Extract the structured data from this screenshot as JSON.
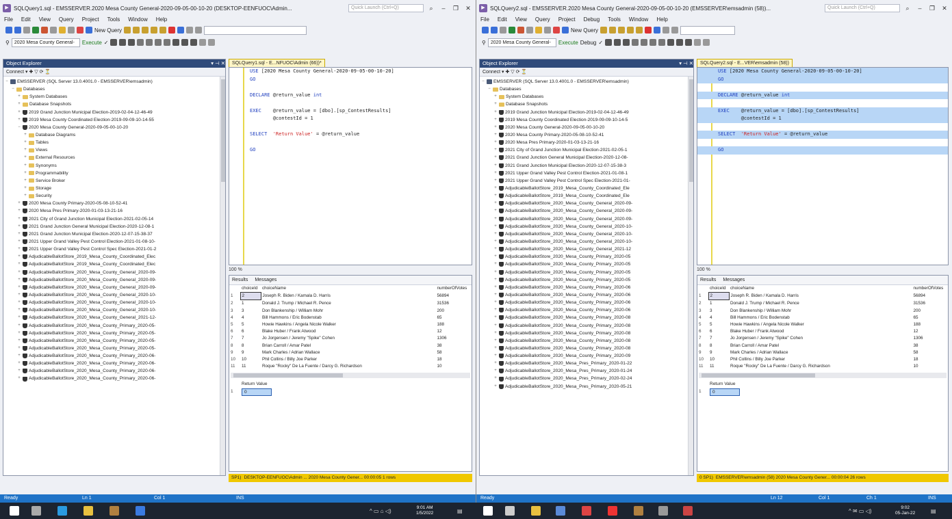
{
  "left": {
    "title": "SQLQuery1.sql - EMSSERVER.2020 Mesa County General-2020-09-05-00-10-20 (DESKTOP-EENFUOC\\Admin...",
    "quick_launch": "Quick Launch (Ctrl+Q)",
    "menu": [
      "File",
      "Edit",
      "View",
      "Query",
      "Project",
      "Tools",
      "Window",
      "Help"
    ],
    "new_query": "New Query",
    "db_combo": "2020 Mesa County General-",
    "execute": "Execute",
    "explorer_title": "Object Explorer",
    "connect": "Connect",
    "server": "EMSSERVER (SQL Server 13.0.4001.0 - EMSSERVER\\emsadmin)",
    "tree": [
      {
        "label": "Databases",
        "level": 1,
        "icon": "folder-icon",
        "ex": "−"
      },
      {
        "label": "System Databases",
        "level": 2,
        "icon": "folder-icon",
        "ex": "+"
      },
      {
        "label": "Database Snapshots",
        "level": 2,
        "icon": "folder-icon",
        "ex": "+"
      },
      {
        "label": "2019 Grand Junction Municipal Election-2019-02-04-12-46-49",
        "level": 2,
        "icon": "database-icon",
        "ex": "+"
      },
      {
        "label": "2019 Mesa County Coordinated Election-2019-09-09-10-14-55",
        "level": 2,
        "icon": "database-icon",
        "ex": "+"
      },
      {
        "label": "2020 Mesa County General-2020-09-05-00-10-20",
        "level": 2,
        "icon": "database-icon",
        "ex": "−"
      },
      {
        "label": "Database Diagrams",
        "level": 3,
        "icon": "folder-icon",
        "ex": "+"
      },
      {
        "label": "Tables",
        "level": 3,
        "icon": "folder-icon",
        "ex": "+"
      },
      {
        "label": "Views",
        "level": 3,
        "icon": "folder-icon",
        "ex": "+"
      },
      {
        "label": "External Resources",
        "level": 3,
        "icon": "folder-icon",
        "ex": "+"
      },
      {
        "label": "Synonyms",
        "level": 3,
        "icon": "folder-icon",
        "ex": "+"
      },
      {
        "label": "Programmability",
        "level": 3,
        "icon": "folder-icon",
        "ex": "+"
      },
      {
        "label": "Service Broker",
        "level": 3,
        "icon": "folder-icon",
        "ex": "+"
      },
      {
        "label": "Storage",
        "level": 3,
        "icon": "folder-icon",
        "ex": "+"
      },
      {
        "label": "Security",
        "level": 3,
        "icon": "folder-icon",
        "ex": "+"
      },
      {
        "label": "2020 Mesa County Primary-2020-05-08-10-52-41",
        "level": 2,
        "icon": "database-icon",
        "ex": "+"
      },
      {
        "label": "2020 Mesa Pres Primary-2020-01-03-13-21-16",
        "level": 2,
        "icon": "database-icon",
        "ex": "+"
      },
      {
        "label": "2021 City of Grand Junction Municipal Election-2021-02-05-14",
        "level": 2,
        "icon": "database-icon",
        "ex": "+"
      },
      {
        "label": "2021 Grand Junction General Municipal Election-2020-12-08-1",
        "level": 2,
        "icon": "database-icon",
        "ex": "+"
      },
      {
        "label": "2021 Grand Junction Municipal Election-2020-12-07-15-38-37",
        "level": 2,
        "icon": "database-icon",
        "ex": "+"
      },
      {
        "label": "2021 Upper Grand Valley Pest Control Election-2021-01-08-10-",
        "level": 2,
        "icon": "database-icon",
        "ex": "+"
      },
      {
        "label": "2021 Upper Grand Valley Pest Control Spec Election-2021-01-2",
        "level": 2,
        "icon": "database-icon",
        "ex": "+"
      },
      {
        "label": "AdjudicableBallotStore_2019_Mesa_County_Coordinated_Elec",
        "level": 2,
        "icon": "database-icon",
        "ex": "+"
      },
      {
        "label": "AdjudicableBallotStore_2019_Mesa_County_Coordinated_Elec",
        "level": 2,
        "icon": "database-icon",
        "ex": "+"
      },
      {
        "label": "AdjudicableBallotStore_2020_Mesa_County_General_2020-09-",
        "level": 2,
        "icon": "database-icon",
        "ex": "+"
      },
      {
        "label": "AdjudicableBallotStore_2020_Mesa_County_General_2020-09-",
        "level": 2,
        "icon": "database-icon",
        "ex": "+"
      },
      {
        "label": "AdjudicableBallotStore_2020_Mesa_County_General_2020-09-",
        "level": 2,
        "icon": "database-icon",
        "ex": "+"
      },
      {
        "label": "AdjudicableBallotStore_2020_Mesa_County_General_2020-10-",
        "level": 2,
        "icon": "database-icon",
        "ex": "+"
      },
      {
        "label": "AdjudicableBallotStore_2020_Mesa_County_General_2020-10-",
        "level": 2,
        "icon": "database-icon",
        "ex": "+"
      },
      {
        "label": "AdjudicableBallotStore_2020_Mesa_County_General_2020-10-",
        "level": 2,
        "icon": "database-icon",
        "ex": "+"
      },
      {
        "label": "AdjudicableBallotStore_2020_Mesa_County_General_2021-12-",
        "level": 2,
        "icon": "database-icon",
        "ex": "+"
      },
      {
        "label": "AdjudicableBallotStore_2020_Mesa_County_Primary_2020-05-",
        "level": 2,
        "icon": "database-icon",
        "ex": "+"
      },
      {
        "label": "AdjudicableBallotStore_2020_Mesa_County_Primary_2020-05-",
        "level": 2,
        "icon": "database-icon",
        "ex": "+"
      },
      {
        "label": "AdjudicableBallotStore_2020_Mesa_County_Primary_2020-05-",
        "level": 2,
        "icon": "database-icon",
        "ex": "+"
      },
      {
        "label": "AdjudicableBallotStore_2020_Mesa_County_Primary_2020-05-",
        "level": 2,
        "icon": "database-icon",
        "ex": "+"
      },
      {
        "label": "AdjudicableBallotStore_2020_Mesa_County_Primary_2020-06-",
        "level": 2,
        "icon": "database-icon",
        "ex": "+"
      },
      {
        "label": "AdjudicableBallotStore_2020_Mesa_County_Primary_2020-06-",
        "level": 2,
        "icon": "database-icon",
        "ex": "+"
      },
      {
        "label": "AdjudicableBallotStore_2020_Mesa_County_Primary_2020-06-",
        "level": 2,
        "icon": "database-icon",
        "ex": "+"
      },
      {
        "label": "AdjudicableBallotStore_2020_Mesa_County_Primary_2020-06-",
        "level": 2,
        "icon": "database-icon",
        "ex": "+"
      }
    ],
    "doc_tab": "SQLQuery1.sql - E...NFUOC\\Admin (66))*",
    "code": [
      {
        "t": [
          [
            "kw",
            "USE "
          ],
          [
            "",
            "[2020 Mesa County General-2020-09-05-00-10-20]"
          ]
        ]
      },
      {
        "t": [
          [
            "kw",
            "GO"
          ]
        ]
      },
      {
        "t": []
      },
      {
        "t": [
          [
            "kw",
            "DECLARE "
          ],
          [
            "",
            "@return_value "
          ],
          [
            "kw",
            "int"
          ]
        ]
      },
      {
        "t": []
      },
      {
        "t": [
          [
            "kw",
            "EXEC    "
          ],
          [
            "",
            "@return_value = [dbo].[sp_ContestResults]"
          ]
        ]
      },
      {
        "t": [
          [
            "",
            "        @contestId = 1"
          ]
        ]
      },
      {
        "t": []
      },
      {
        "t": [
          [
            "kw",
            "SELECT  "
          ],
          [
            "str",
            "'Return Value'"
          ],
          [
            "",
            " = @return_value"
          ]
        ]
      },
      {
        "t": []
      },
      {
        "t": [
          [
            "kw",
            "GO"
          ]
        ]
      }
    ],
    "zoom": "100 %",
    "results_tab": "Results",
    "messages_tab": "Messages",
    "status": "DESKTOP-EENFUOC\\Admin ...   2020 Mesa County Gener...   00:00:05   1 rows",
    "status_left": "SP1)",
    "vs_status": {
      "ready": "Ready",
      "ln": "Ln 1",
      "col": "Col 1",
      "ins": "INS"
    }
  },
  "right": {
    "title": "SQLQuery2.sql - EMSSERVER.2020 Mesa County General-2020-09-05-00-10-20 (EMSSERVER\\emsadmin (58))...",
    "quick_launch": "Quick Launch (Ctrl+Q)",
    "menu": [
      "File",
      "Edit",
      "View",
      "Query",
      "Project",
      "Debug",
      "Tools",
      "Window",
      "Help"
    ],
    "new_query": "New Query",
    "db_combo": "2020 Mesa County General-",
    "execute": "Execute",
    "debug": "Debug",
    "explorer_title": "Object Explorer",
    "connect": "Connect",
    "server": "EMSSERVER (SQL Server 13.0.4001.0 - EMSSERVER\\emsadmin)",
    "tree": [
      {
        "label": "Databases",
        "level": 1,
        "icon": "folder-icon",
        "ex": "−"
      },
      {
        "label": "System Databases",
        "level": 2,
        "icon": "folder-icon",
        "ex": "+"
      },
      {
        "label": "Database Snapshots",
        "level": 2,
        "icon": "folder-icon",
        "ex": "+"
      },
      {
        "label": "2019 Grand Junction Municipal Election-2019-02-04-12-46-49",
        "level": 2,
        "icon": "database-icon",
        "ex": "+"
      },
      {
        "label": "2019 Mesa County Coordinated Election-2019-09-09-10-14-5",
        "level": 2,
        "icon": "database-icon",
        "ex": "+"
      },
      {
        "label": "2020 Mesa County General-2020-09-05-00-10-20",
        "level": 2,
        "icon": "database-icon",
        "ex": "+"
      },
      {
        "label": "2020 Mesa County Primary-2020-05-08-10-52-41",
        "level": 2,
        "icon": "database-icon",
        "ex": "+"
      },
      {
        "label": "2020 Mesa Pres Primary-2020-01-03-13-21-16",
        "level": 2,
        "icon": "database-icon",
        "ex": "+"
      },
      {
        "label": "2021 City of Grand Junction Municipal Election-2021-02-05-1",
        "level": 2,
        "icon": "database-icon",
        "ex": "+"
      },
      {
        "label": "2021 Grand Junction General Municipal Election-2020-12-08-",
        "level": 2,
        "icon": "database-icon",
        "ex": "+"
      },
      {
        "label": "2021 Grand Junction Municipal Election-2020-12-07-15-38-3",
        "level": 2,
        "icon": "database-icon",
        "ex": "+"
      },
      {
        "label": "2021 Upper Grand Valley Pest Control Election-2021-01-08-1",
        "level": 2,
        "icon": "database-icon",
        "ex": "+"
      },
      {
        "label": "2021 Upper Grand Valley Pest Control Spec Election-2021-01-",
        "level": 2,
        "icon": "database-icon",
        "ex": "+"
      },
      {
        "label": "AdjudicableBallotStore_2019_Mesa_County_Coordinated_Ele",
        "level": 2,
        "icon": "database-icon",
        "ex": "+"
      },
      {
        "label": "AdjudicableBallotStore_2019_Mesa_County_Coordinated_Ele",
        "level": 2,
        "icon": "database-icon",
        "ex": "+"
      },
      {
        "label": "AdjudicableBallotStore_2020_Mesa_County_General_2020-09-",
        "level": 2,
        "icon": "database-icon",
        "ex": "+"
      },
      {
        "label": "AdjudicableBallotStore_2020_Mesa_County_General_2020-09-",
        "level": 2,
        "icon": "database-icon",
        "ex": "+"
      },
      {
        "label": "AdjudicableBallotStore_2020_Mesa_County_General_2020-09-",
        "level": 2,
        "icon": "database-icon",
        "ex": "+"
      },
      {
        "label": "AdjudicableBallotStore_2020_Mesa_County_General_2020-10-",
        "level": 2,
        "icon": "database-icon",
        "ex": "+"
      },
      {
        "label": "AdjudicableBallotStore_2020_Mesa_County_General_2020-10-",
        "level": 2,
        "icon": "database-icon",
        "ex": "+"
      },
      {
        "label": "AdjudicableBallotStore_2020_Mesa_County_General_2020-10-",
        "level": 2,
        "icon": "database-icon",
        "ex": "+"
      },
      {
        "label": "AdjudicableBallotStore_2020_Mesa_County_General_2021-12",
        "level": 2,
        "icon": "database-icon",
        "ex": "+"
      },
      {
        "label": "AdjudicableBallotStore_2020_Mesa_County_Primary_2020-05",
        "level": 2,
        "icon": "database-icon",
        "ex": "+"
      },
      {
        "label": "AdjudicableBallotStore_2020_Mesa_County_Primary_2020-05",
        "level": 2,
        "icon": "database-icon",
        "ex": "+"
      },
      {
        "label": "AdjudicableBallotStore_2020_Mesa_County_Primary_2020-05",
        "level": 2,
        "icon": "database-icon",
        "ex": "+"
      },
      {
        "label": "AdjudicableBallotStore_2020_Mesa_County_Primary_2020-05",
        "level": 2,
        "icon": "database-icon",
        "ex": "+"
      },
      {
        "label": "AdjudicableBallotStore_2020_Mesa_County_Primary_2020-06",
        "level": 2,
        "icon": "database-icon",
        "ex": "+"
      },
      {
        "label": "AdjudicableBallotStore_2020_Mesa_County_Primary_2020-06",
        "level": 2,
        "icon": "database-icon",
        "ex": "+"
      },
      {
        "label": "AdjudicableBallotStore_2020_Mesa_County_Primary_2020-06",
        "level": 2,
        "icon": "database-icon",
        "ex": "+"
      },
      {
        "label": "AdjudicableBallotStore_2020_Mesa_County_Primary_2020-06",
        "level": 2,
        "icon": "database-icon",
        "ex": "+"
      },
      {
        "label": "AdjudicableBallotStore_2020_Mesa_County_Primary_2020-08",
        "level": 2,
        "icon": "database-icon",
        "ex": "+"
      },
      {
        "label": "AdjudicableBallotStore_2020_Mesa_County_Primary_2020-08",
        "level": 2,
        "icon": "database-icon",
        "ex": "+"
      },
      {
        "label": "AdjudicableBallotStore_2020_Mesa_County_Primary_2020-08",
        "level": 2,
        "icon": "database-icon",
        "ex": "+"
      },
      {
        "label": "AdjudicableBallotStore_2020_Mesa_County_Primary_2020-08",
        "level": 2,
        "icon": "database-icon",
        "ex": "+"
      },
      {
        "label": "AdjudicableBallotStore_2020_Mesa_County_Primary_2020-08",
        "level": 2,
        "icon": "database-icon",
        "ex": "+"
      },
      {
        "label": "AdjudicableBallotStore_2020_Mesa_County_Primary_2020-09",
        "level": 2,
        "icon": "database-icon",
        "ex": "+"
      },
      {
        "label": "AdjudicableBallotStore_2020_Mesa_Pres_Primary_2020-01-22",
        "level": 2,
        "icon": "database-icon",
        "ex": "+"
      },
      {
        "label": "AdjudicableBallotStore_2020_Mesa_Pres_Primary_2020-01-24",
        "level": 2,
        "icon": "database-icon",
        "ex": "+"
      },
      {
        "label": "AdjudicableBallotStore_2020_Mesa_Pres_Primary_2020-02-24",
        "level": 2,
        "icon": "database-icon",
        "ex": "+"
      },
      {
        "label": "AdjudicableBallotStore_2020_Mesa_Pres_Primary_2020-05-21",
        "level": 2,
        "icon": "database-icon",
        "ex": "+"
      }
    ],
    "doc_tab": "SQLQuery2.sql - E...VER\\emsadmin (58))",
    "code": [
      {
        "t": [
          [
            "kw",
            "USE "
          ],
          [
            "",
            "[2020 Mesa County General-2020-09-05-00-10-20]"
          ]
        ]
      },
      {
        "t": [
          [
            "kw",
            "GO"
          ]
        ]
      },
      {
        "t": []
      },
      {
        "t": [
          [
            "kw",
            "DECLARE "
          ],
          [
            "",
            "@return_value "
          ],
          [
            "kw",
            "int"
          ]
        ]
      },
      {
        "t": []
      },
      {
        "t": [
          [
            "kw",
            "EXEC    "
          ],
          [
            "",
            "@return_value = [dbo].[sp_ContestResults]"
          ]
        ]
      },
      {
        "t": [
          [
            "",
            "        @contestId = 1"
          ]
        ]
      },
      {
        "t": []
      },
      {
        "t": [
          [
            "kw",
            "SELECT  "
          ],
          [
            "str",
            "'Return Value'"
          ],
          [
            "",
            " = @return_value"
          ]
        ]
      },
      {
        "t": []
      },
      {
        "t": [
          [
            "kw",
            "GO"
          ]
        ]
      }
    ],
    "zoom": "100 %",
    "results_tab": "Results",
    "messages_tab": "Messages",
    "status": "EMSSERVER\\emsadmin (58)   2020 Mesa County Gener...   00:00:04   26 rows",
    "status_left": "0 SP1)",
    "vs_status": {
      "ready": "Ready",
      "ln": "Ln 12",
      "col": "Col 1",
      "ch": "Ch 1",
      "ins": "INS"
    }
  },
  "results": {
    "headers": [
      "choiceId",
      "choiceName",
      "numberOfVotes"
    ],
    "rows": [
      [
        "1",
        "2",
        "Joseph R. Biden / Kamala D. Harris",
        "56894"
      ],
      [
        "2",
        "1",
        "Donald J. Trump / Michael R. Pence",
        "31536"
      ],
      [
        "3",
        "3",
        "Don Blankenship / William Mohr",
        "200"
      ],
      [
        "4",
        "4",
        "Bill Hammons / Eric Bodenstab",
        "65"
      ],
      [
        "5",
        "5",
        "Howie Hawkins / Angela Nicole Walker",
        "188"
      ],
      [
        "6",
        "6",
        "Blake Huber / Frank Atwood",
        "12"
      ],
      [
        "7",
        "7",
        "Jo Jorgensen / Jeremy \"Spike\" Cohen",
        "1306"
      ],
      [
        "8",
        "8",
        "Brian Carroll / Amar Patel",
        "38"
      ],
      [
        "9",
        "9",
        "Mark Charles / Adrian Wallace",
        "58"
      ],
      [
        "10",
        "10",
        "Phil Collins / Billy Joe Parker",
        "18"
      ],
      [
        "11",
        "11",
        "Roque \"Rocky\" De La Fuente / Darcy G. Richardson",
        "10"
      ]
    ],
    "return_header": "Return Value",
    "return_row": "1",
    "return_value": "0"
  },
  "taskbar": {
    "left_clock": {
      "time": "9:01 AM",
      "date": "1/5/2022"
    },
    "right_clock": {
      "time": "9:02",
      "date": "05-Jan-22"
    }
  }
}
